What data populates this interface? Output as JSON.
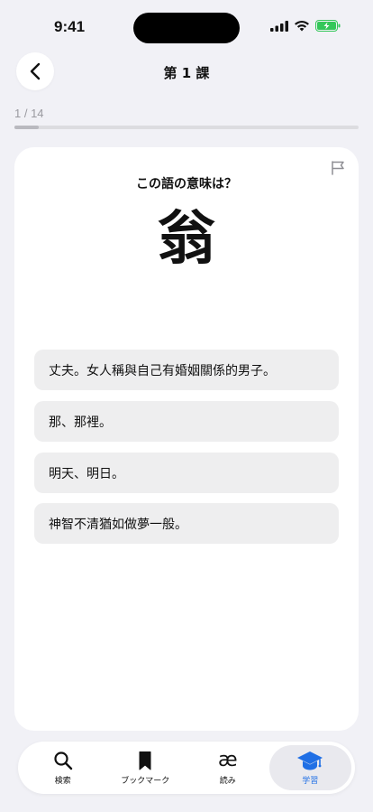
{
  "status_bar": {
    "time": "9:41"
  },
  "header": {
    "title": "第 1 課"
  },
  "progress": {
    "text": "1 / 14",
    "fraction": 0.0714
  },
  "card": {
    "question": "この語の意味は？",
    "word": "翁",
    "choices": [
      "丈夫。女人稱與自己有婚姻關係的男子。",
      "那、那裡。",
      "明天、明日。",
      "神智不清猶如做夢一般。"
    ]
  },
  "tabbar": {
    "tabs": [
      {
        "label": "検索",
        "icon": "search-icon"
      },
      {
        "label": "ブックマーク",
        "icon": "bookmark-icon"
      },
      {
        "label": "読み",
        "icon": "ae-ligature-icon",
        "glyph": "æ"
      },
      {
        "label": "学習",
        "icon": "graduation-cap-icon"
      }
    ],
    "active_index": 3
  },
  "colors": {
    "accent": "#1f6fe5",
    "background": "#f1f1f6",
    "choice_bg": "#eeeeef"
  }
}
